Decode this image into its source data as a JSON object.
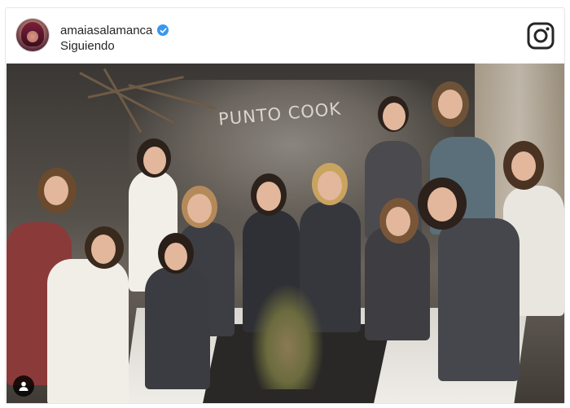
{
  "post": {
    "username": "amaiasalamanca",
    "follow_status": "Siguiendo",
    "verified": true,
    "photo_text": "PUNTO COOK",
    "icons": {
      "verified": "verified-badge-icon",
      "brand": "instagram-icon",
      "tag": "user-tag-icon"
    }
  },
  "colors": {
    "verified_blue": "#3897f0",
    "text": "#262626",
    "border": "#e6e6e6"
  }
}
